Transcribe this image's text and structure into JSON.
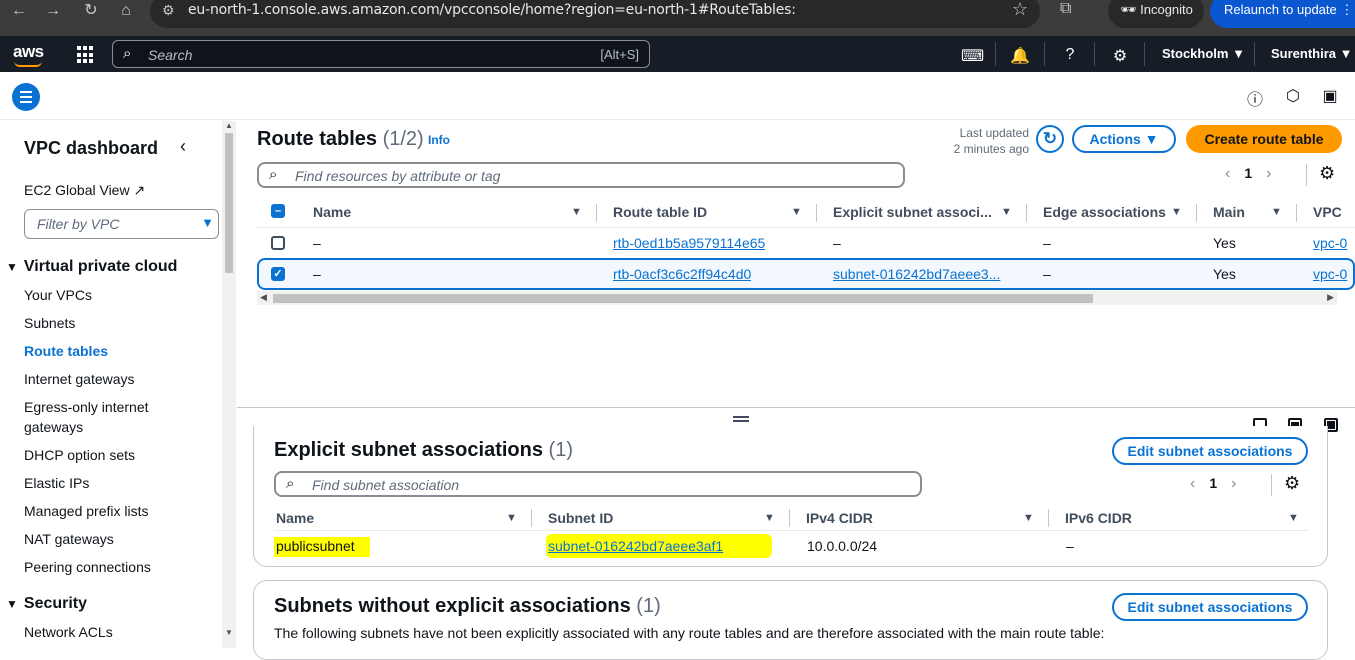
{
  "browser": {
    "url": "eu-north-1.console.aws.amazon.com/vpcconsole/home?region=eu-north-1#RouteTables:",
    "incognito_label": "Incognito",
    "relaunch_label": "Relaunch to update"
  },
  "aws_nav": {
    "logo": "aws",
    "search_placeholder": "Search",
    "search_shortcut": "[Alt+S]",
    "region": "Stockholm ▼",
    "user": "Surenthira ▼"
  },
  "sidebar": {
    "title": "VPC dashboard",
    "ec2_global_view": "EC2 Global View",
    "filter_placeholder": "Filter by VPC",
    "section_vpc": "Virtual private cloud",
    "items": [
      {
        "label": "Your VPCs"
      },
      {
        "label": "Subnets"
      },
      {
        "label": "Route tables"
      },
      {
        "label": "Internet gateways"
      },
      {
        "label": "Egress-only internet"
      },
      {
        "label": "gateways"
      },
      {
        "label": "DHCP option sets"
      },
      {
        "label": "Elastic IPs"
      },
      {
        "label": "Managed prefix lists"
      },
      {
        "label": "NAT gateways"
      },
      {
        "label": "Peering connections"
      }
    ],
    "section_security": "Security",
    "security_items": [
      {
        "label": "Network ACLs"
      }
    ]
  },
  "route_tables": {
    "title": "Route tables",
    "count": "(1/2)",
    "info": "Info",
    "last_updated_line1": "Last updated",
    "last_updated_line2": "2 minutes ago",
    "actions_label": "Actions ▼",
    "create_label": "Create route table",
    "find_placeholder": "Find resources by attribute or tag",
    "page": "1",
    "columns": [
      "Name",
      "Route table ID",
      "Explicit subnet associ...",
      "Edge associations",
      "Main",
      "VPC"
    ],
    "rows": [
      {
        "name": "–",
        "id": "rtb-0ed1b5a9579114e65",
        "explicit": "–",
        "edge": "–",
        "main": "Yes",
        "vpc": "vpc-0",
        "selected": false
      },
      {
        "name": "–",
        "id": "rtb-0acf3c6c2ff94c4d0",
        "explicit": "subnet-016242bd7aeee3...",
        "edge": "–",
        "main": "Yes",
        "vpc": "vpc-0",
        "selected": true
      }
    ]
  },
  "explicit_panel": {
    "title": "Explicit subnet associations",
    "count": "(1)",
    "edit_label": "Edit subnet associations",
    "find_placeholder": "Find subnet association",
    "page": "1",
    "columns": [
      "Name",
      "Subnet ID",
      "IPv4 CIDR",
      "IPv6 CIDR"
    ],
    "rows": [
      {
        "name": "publicsubnet",
        "subnet_id": "subnet-016242bd7aeee3af1",
        "ipv4": "10.0.0.0/24",
        "ipv6": "–"
      }
    ]
  },
  "without_panel": {
    "title": "Subnets without explicit associations",
    "count": "(1)",
    "edit_label": "Edit subnet associations",
    "description": "The following subnets have not been explicitly associated with any route tables and are therefore associated with the main route table:"
  }
}
